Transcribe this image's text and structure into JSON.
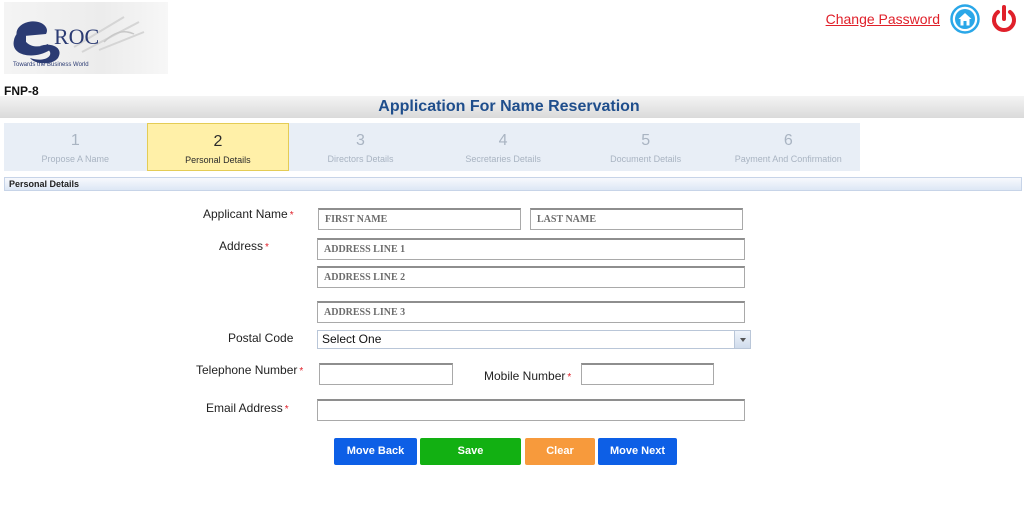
{
  "header": {
    "logo_text": "eROC",
    "logo_tagline": "Towards the Business World",
    "change_password": "Change Password"
  },
  "form_code": "FNP-8",
  "title": "Application For Name Reservation",
  "steps": [
    {
      "num": "1",
      "label": "Propose A Name",
      "active": false
    },
    {
      "num": "2",
      "label": "Personal Details",
      "active": true
    },
    {
      "num": "3",
      "label": "Directors Details",
      "active": false
    },
    {
      "num": "4",
      "label": "Secretaries Details",
      "active": false
    },
    {
      "num": "5",
      "label": "Document Details",
      "active": false
    },
    {
      "num": "6",
      "label": "Payment And Confirmation",
      "active": false
    }
  ],
  "section_title": "Personal Details",
  "form": {
    "applicant_name_label": "Applicant Name",
    "first_name_placeholder": "FIRST NAME",
    "last_name_placeholder": "LAST NAME",
    "address_label": "Address",
    "address1_placeholder": "ADDRESS LINE 1",
    "address2_placeholder": "ADDRESS LINE 2",
    "address3_placeholder": "ADDRESS LINE 3",
    "postal_code_label": "Postal Code",
    "postal_code_value": "Select One",
    "telephone_label": "Telephone Number",
    "mobile_label": "Mobile Number",
    "email_label": "Email Address",
    "required_mark": "*"
  },
  "buttons": {
    "move_back": "Move Back",
    "save": "Save",
    "clear": "Clear",
    "move_next": "Move Next"
  },
  "colors": {
    "brand_blue": "#1f4e8c",
    "button_blue": "#0d5fe6",
    "button_green": "#12b012",
    "button_orange": "#f79a3c",
    "required_red": "#e0202a",
    "active_step": "#fff0a8"
  },
  "icons": {
    "home": "home-icon",
    "logout": "power-icon"
  }
}
